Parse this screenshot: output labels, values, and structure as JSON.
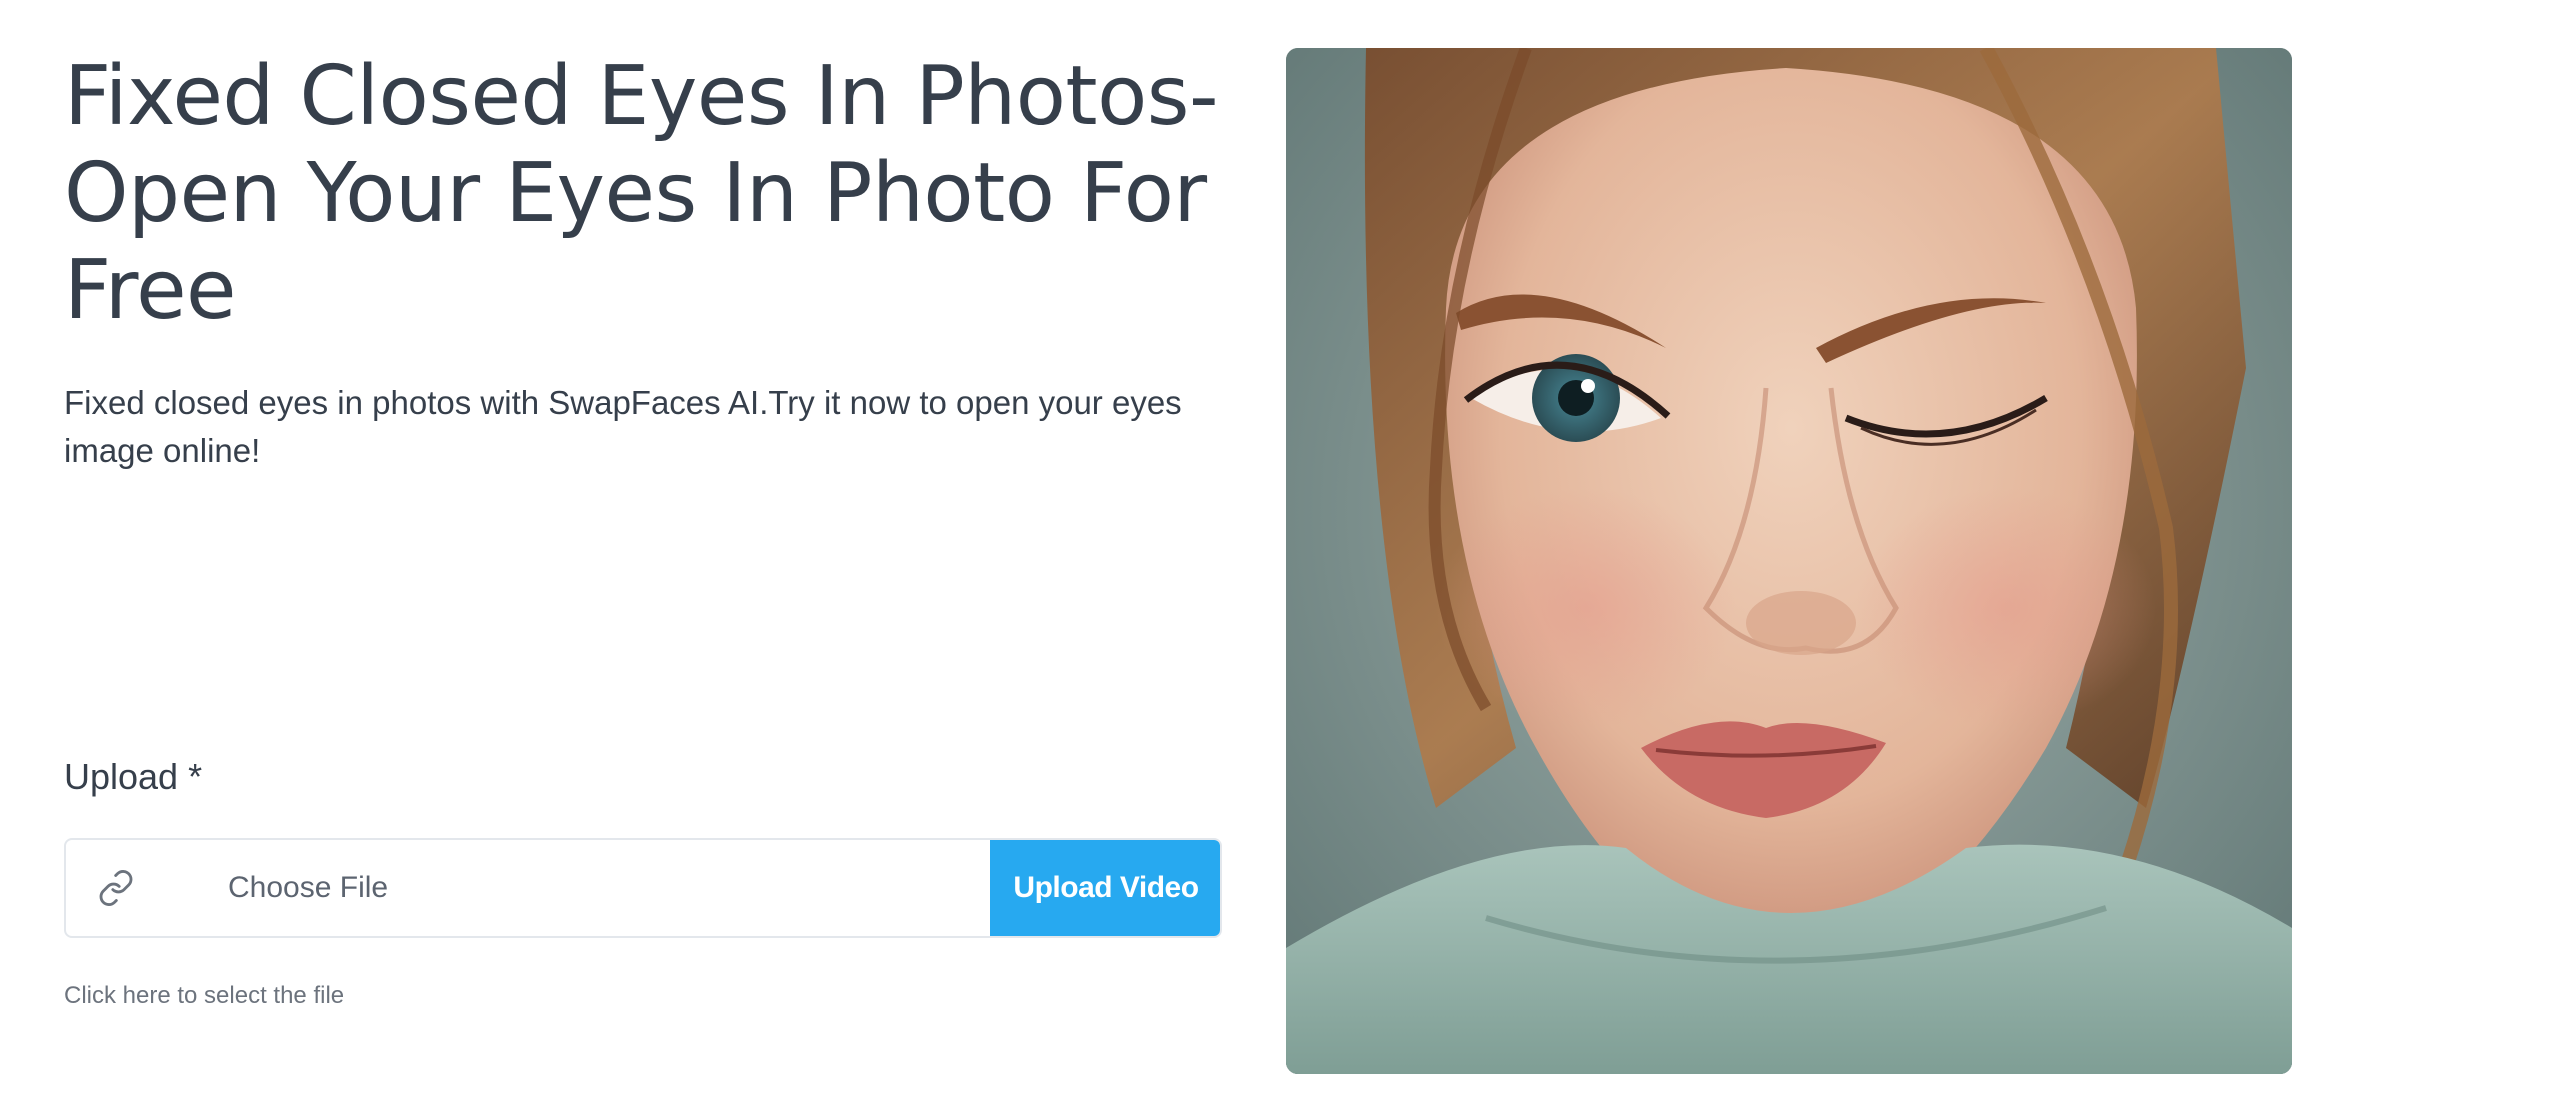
{
  "hero": {
    "title": "Fixed Closed Eyes In Photos- Open Your Eyes In Photo For Free",
    "description": "Fixed closed eyes in photos with SwapFaces AI.Try it now to open your eyes image online!"
  },
  "upload": {
    "label": "Upload *",
    "file_placeholder": "Choose File",
    "button_label": "Upload Video",
    "hint": "Click here to select the file",
    "icon": "link-icon"
  },
  "colors": {
    "button": "#27a9f0",
    "text": "#363f4b",
    "border": "#e3e7ec"
  }
}
